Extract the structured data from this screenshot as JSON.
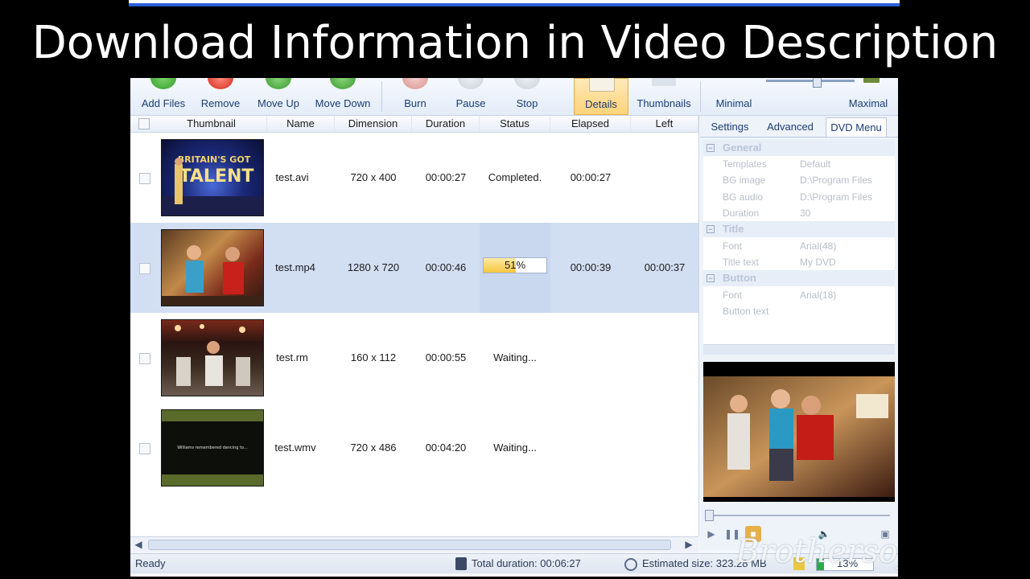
{
  "banner": {
    "title": "Download Information in Video Description"
  },
  "toolbar": {
    "add_files": "Add Files",
    "remove": "Remove",
    "move_up": "Move Up",
    "move_down": "Move Down",
    "burn": "Burn",
    "pause": "Pause",
    "stop": "Stop",
    "details": "Details",
    "thumbnails": "Thumbnails",
    "minimal": "Minimal",
    "maximal": "Maximal"
  },
  "columns": [
    "Thumbnail",
    "Name",
    "Dimension",
    "Duration",
    "Status",
    "Elapsed",
    "Left"
  ],
  "rows": [
    {
      "name": "test.avi",
      "dimension": "720 x 400",
      "duration": "00:00:27",
      "status": "Completed.",
      "elapsed": "00:00:27",
      "left": ""
    },
    {
      "name": "test.mp4",
      "dimension": "1280 x 720",
      "duration": "00:00:46",
      "status": "51%",
      "progress": 0.51,
      "elapsed": "00:00:39",
      "left": "00:00:37"
    },
    {
      "name": "test.rm",
      "dimension": "160 x 112",
      "duration": "00:00:55",
      "status": "Waiting...",
      "elapsed": "",
      "left": ""
    },
    {
      "name": "test.wmv",
      "dimension": "720 x 486",
      "duration": "00:04:20",
      "status": "Waiting...",
      "elapsed": "",
      "left": ""
    }
  ],
  "tabs": [
    "Settings",
    "Advanced",
    "DVD Menu"
  ],
  "properties": {
    "general": {
      "heading": "General",
      "templates_k": "Templates",
      "templates_v": "Default",
      "bg_image_k": "BG image",
      "bg_image_v": "D:\\Program Files",
      "bg_audio_k": "BG audio",
      "bg_audio_v": "D:\\Program Files",
      "duration_k": "Duration",
      "duration_v": "30"
    },
    "title": {
      "heading": "Title",
      "font_k": "Font",
      "font_v": "Arial(48)",
      "text_k": "Title text",
      "text_v": "My DVD"
    },
    "button": {
      "heading": "Button",
      "font_k": "Font",
      "font_v": "Arial(18)",
      "text_k": "Button text"
    }
  },
  "status": {
    "ready": "Ready",
    "total_duration": "Total duration: 00:06:27",
    "estimated_size": "Estimated size: 323.28 MB",
    "percent": "13%",
    "percent_value": 0.13
  },
  "thumb_text": "Williams remembered dancing to...",
  "watermark": "Brothersoft",
  "colors": {
    "selected_row": "#d2def2",
    "progress": "#f5c542",
    "accent": "#1b3d74",
    "status_green": "#2fa84f"
  }
}
